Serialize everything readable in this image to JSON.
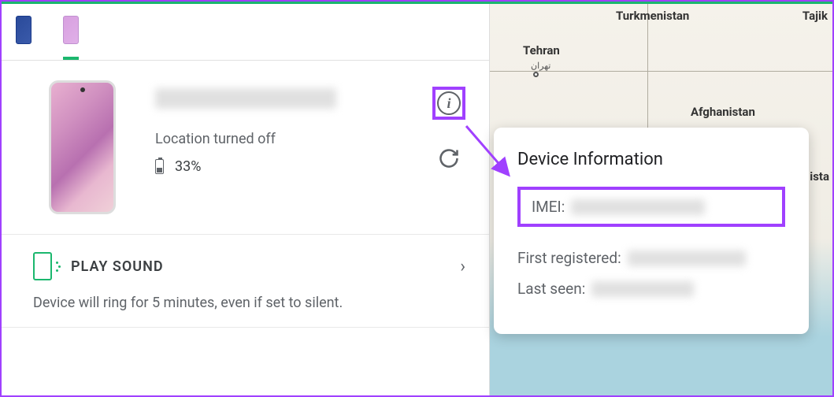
{
  "device": {
    "name": "[redacted device name]",
    "location_status": "Location turned off",
    "battery_percent": "33%"
  },
  "action": {
    "label": "PLAY SOUND",
    "description": "Device will ring for 5 minutes, even if set to silent."
  },
  "popup": {
    "title": "Device Information",
    "imei_label": "IMEI:",
    "first_registered_label": "First registered:",
    "last_seen_label": "Last seen:"
  },
  "map": {
    "labels": {
      "turkmenistan": "Turkmenistan",
      "tehran": "Tehran",
      "afghanistan": "Afghanistan",
      "tajik": "Tajik",
      "ista": "ista"
    }
  }
}
